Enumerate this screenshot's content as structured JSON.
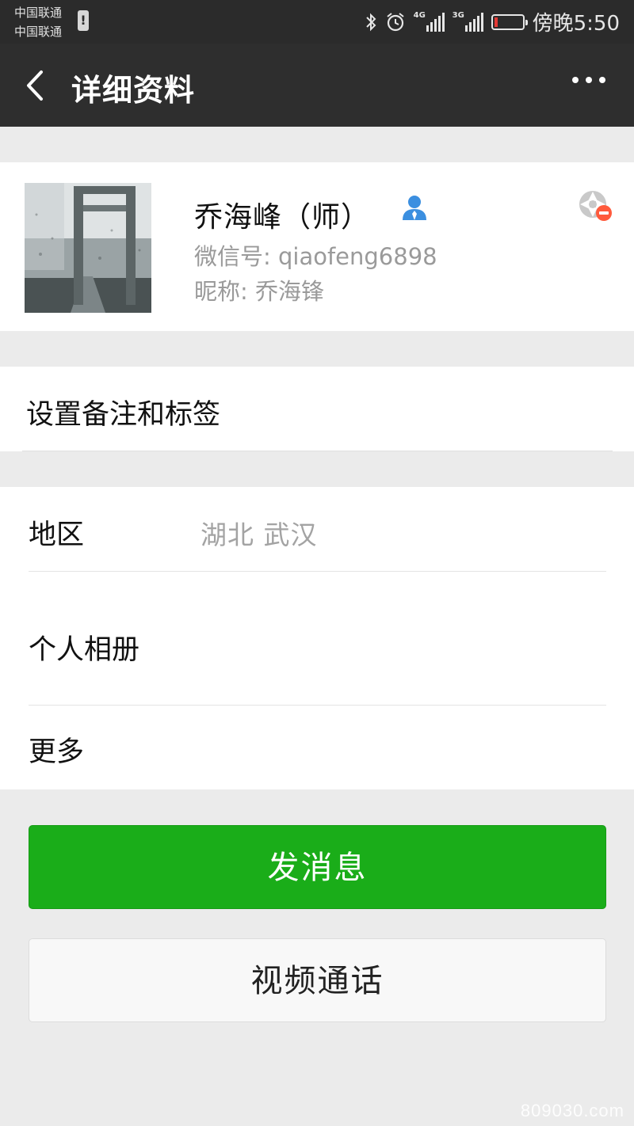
{
  "status_bar": {
    "carrier_1": "中国联通",
    "carrier_2": "中国联通",
    "sim_alert": "!",
    "network_1": "4G",
    "network_2": "3G",
    "time": "傍晚5:50",
    "battery_level": 0.1,
    "battery_color": "#e53935",
    "icons": [
      "bluetooth-icon",
      "alarm-icon",
      "signal-icon",
      "battery-icon"
    ]
  },
  "nav": {
    "title": "详细资料",
    "back_icon": "chevron-left-icon",
    "more_icon": "more-dots-icon"
  },
  "profile": {
    "name": "乔海峰（师）",
    "wechat_id": "微信号: qiaofeng6898",
    "nickname": "昵称: 乔海锋",
    "contact_icon": "contact-person-icon",
    "status_icon": "moments-blocked-icon"
  },
  "remark": {
    "label": "设置备注和标签"
  },
  "info": {
    "region_label": "地区",
    "region_value": "湖北  武汉",
    "album_label": "个人相册",
    "more_label": "更多"
  },
  "actions": {
    "message_label": "发消息",
    "video_call_label": "视频通话",
    "primary_color": "#1aad19"
  },
  "watermark": "809030.com"
}
